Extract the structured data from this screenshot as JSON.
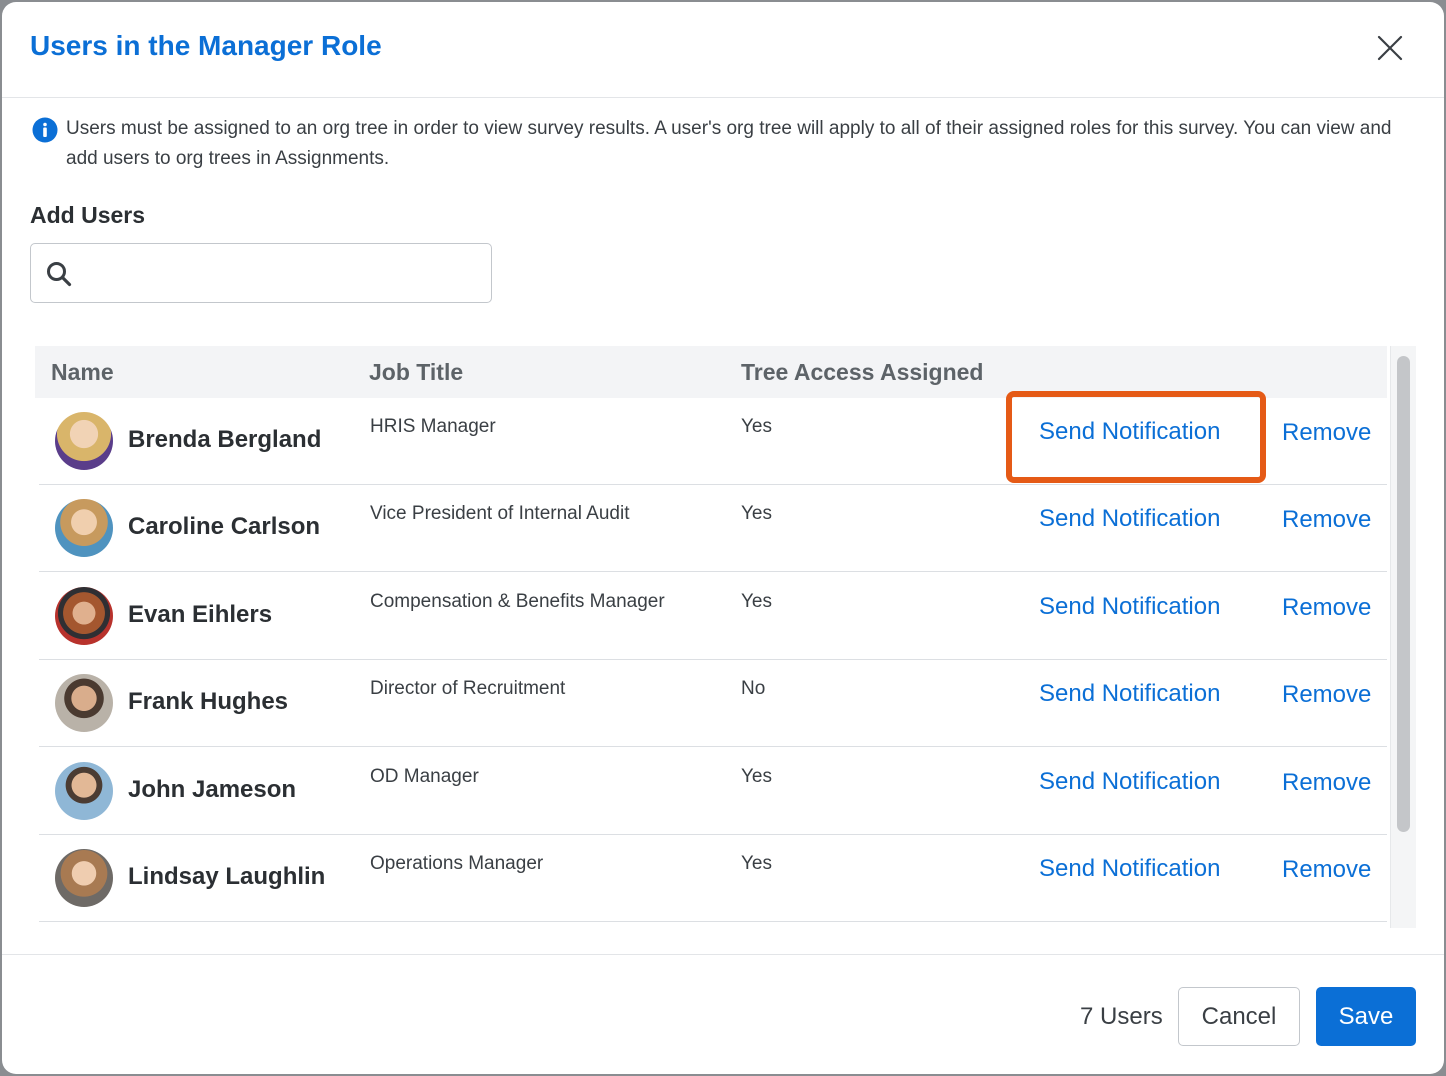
{
  "dialog": {
    "title": "Users in the Manager Role",
    "close_icon": "close-icon"
  },
  "info": {
    "icon": "info-icon",
    "text": "Users must be assigned to an org tree in order to view survey results. A user's org tree will apply to all of their assigned roles for this survey. You can view and add users to org trees in Assignments."
  },
  "add_users": {
    "label": "Add Users",
    "search_icon": "search-icon",
    "search_value": ""
  },
  "table": {
    "headers": {
      "name": "Name",
      "job_title": "Job Title",
      "tree_access": "Tree Access Assigned"
    },
    "rows": [
      {
        "name": "Brenda Bergland",
        "job_title": "HRIS Manager",
        "tree_access": "Yes",
        "send": "Send Notification",
        "remove": "Remove",
        "avatar_color": "#c9a56b"
      },
      {
        "name": "Caroline Carlson",
        "job_title": "Vice President of Internal Audit",
        "tree_access": "Yes",
        "send": "Send Notification",
        "remove": "Remove",
        "avatar_color": "#5a9fc4"
      },
      {
        "name": "Evan Eihlers",
        "job_title": "Compensation & Benefits Manager",
        "tree_access": "Yes",
        "send": "Send Notification",
        "remove": "Remove",
        "avatar_color": "#b84a3a"
      },
      {
        "name": "Frank Hughes",
        "job_title": "Director of Recruitment",
        "tree_access": "No",
        "send": "Send Notification",
        "remove": "Remove",
        "avatar_color": "#9a8a7a"
      },
      {
        "name": "John Jameson",
        "job_title": "OD Manager",
        "tree_access": "Yes",
        "send": "Send Notification",
        "remove": "Remove",
        "avatar_color": "#7aa4c4"
      },
      {
        "name": "Lindsay Laughlin",
        "job_title": "Operations Manager",
        "tree_access": "Yes",
        "send": "Send Notification",
        "remove": "Remove",
        "avatar_color": "#8a7a6a"
      }
    ]
  },
  "footer": {
    "count": "7 Users",
    "cancel_label": "Cancel",
    "save_label": "Save"
  },
  "colors": {
    "accent": "#0b6fd6",
    "highlight": "#e55a16"
  }
}
